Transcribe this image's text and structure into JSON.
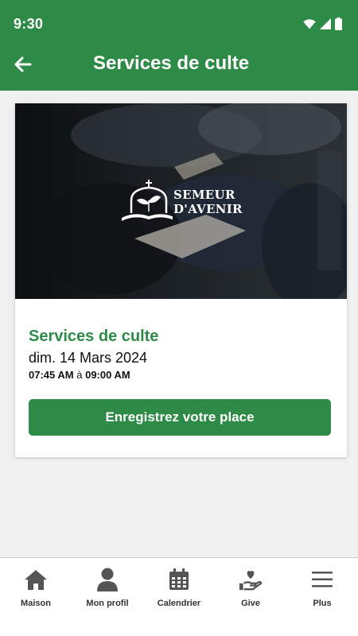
{
  "status_bar": {
    "time": "9:30",
    "icons": [
      "wifi-icon",
      "signal-icon",
      "battery-icon"
    ]
  },
  "app_bar": {
    "title": "Services de culte",
    "back_icon": "arrow-left-icon"
  },
  "event": {
    "image_logo": {
      "line1": "SEMEUR",
      "line2": "D'AVENIR"
    },
    "title": "Services de culte",
    "date": "dim. 14 Mars 2024",
    "start_time": "07:45 AM",
    "time_separator": "à",
    "end_time": "09:00 AM",
    "register_label": "Enregistrez votre place"
  },
  "bottom_nav": [
    {
      "label": "Maison",
      "icon": "home-icon"
    },
    {
      "label": "Mon profil",
      "icon": "person-icon"
    },
    {
      "label": "Calendrier",
      "icon": "calendar-icon"
    },
    {
      "label": "Give",
      "icon": "give-heart-icon"
    },
    {
      "label": "Plus",
      "icon": "menu-icon"
    }
  ],
  "colors": {
    "primary": "#2e8b47",
    "background": "#f0f0f0",
    "nav_icon": "#555555"
  }
}
